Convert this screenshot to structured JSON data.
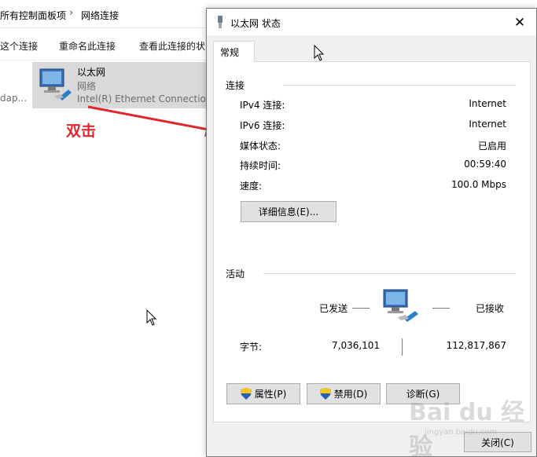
{
  "explorer": {
    "breadcrumb": [
      "所有控制面板项",
      "网络连接"
    ],
    "breadcrumb_sep": "›",
    "commands": [
      "这个连接",
      "重命名此连接",
      "查看此连接的状"
    ],
    "partial_adapter_text": "dap...",
    "adapter": {
      "name": "以太网",
      "status": "网络",
      "description": "Intel(R) Ethernet Connection"
    }
  },
  "annotation": {
    "text": "双击",
    "color": "#e0262a"
  },
  "dialog": {
    "title": "以太网 状态",
    "close_glyph": "✕",
    "tab_label": "常规",
    "connection": {
      "group_label": "连接",
      "rows": [
        {
          "label": "IPv4 连接:",
          "value": "Internet"
        },
        {
          "label": "IPv6 连接:",
          "value": "Internet"
        },
        {
          "label": "媒体状态:",
          "value": "已启用"
        },
        {
          "label": "持续时间:",
          "value": "00:59:40"
        },
        {
          "label": "速度:",
          "value": "100.0 Mbps"
        }
      ],
      "details_button": "详细信息(E)..."
    },
    "activity": {
      "group_label": "活动",
      "sent_label": "已发送",
      "received_label": "已接收",
      "bytes_label": "字节:",
      "bytes_sent": "7,036,101",
      "bytes_received": "112,817,867"
    },
    "buttons": {
      "properties": "属性(P)",
      "disable": "禁用(D)",
      "diagnose": "诊断(G)",
      "close": "关闭(C)"
    }
  },
  "watermark": {
    "text": "Bai du 经验",
    "sub": "jingyan.baidu.com"
  },
  "colors": {
    "dialog_bg": "#f0f0f0",
    "panel_bg": "#ffffff",
    "button_bg": "#e1e1e1",
    "selection": "#d9d9d9",
    "accent_red": "#e0262a"
  }
}
